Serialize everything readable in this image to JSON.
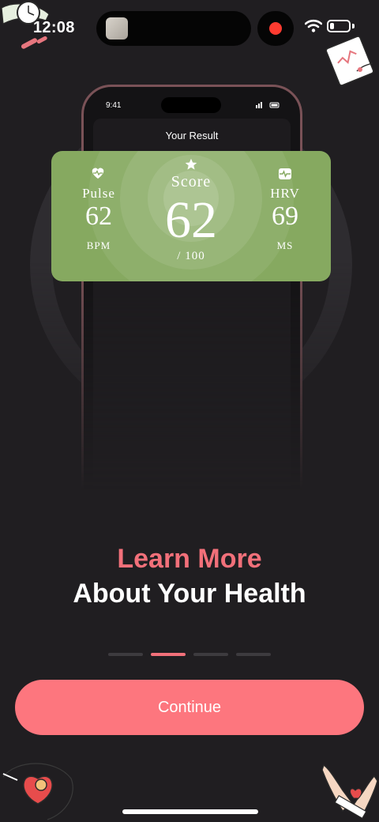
{
  "status_bar": {
    "time": "12:08"
  },
  "phone_mock": {
    "time": "9:41",
    "sheet_title": "Your Result"
  },
  "result_card": {
    "pulse": {
      "label": "Pulse",
      "value": "62",
      "unit": "BPM"
    },
    "score": {
      "label": "Score",
      "value": "62",
      "out_of": "/ 100"
    },
    "hrv": {
      "label": "HRV",
      "value": "69",
      "unit": "MS"
    }
  },
  "headline": {
    "line1": "Learn More",
    "line2": "About Your Health"
  },
  "pager": {
    "count": 4,
    "active_index": 1
  },
  "continue_button": {
    "label": "Continue"
  },
  "colors": {
    "background": "#201e21",
    "accent": "#f2707a",
    "button": "#fd767e",
    "card_green": "#86a960"
  }
}
